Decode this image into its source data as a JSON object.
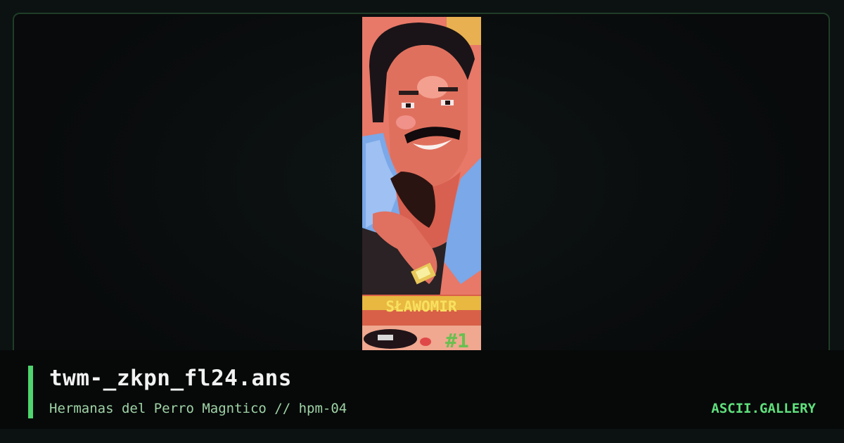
{
  "artwork": {
    "title": "twm-_zkpn_fl24.ans",
    "artist_line": "Hermanas del Perro Magntico // hpm-04",
    "banner_text": "SŁAWOMIR",
    "issue_mark": "#1"
  },
  "brand": {
    "label": "ASCII.GALLERY"
  },
  "colors": {
    "accent": "#4ed56f",
    "brand": "#5fe07c",
    "subtitle": "#9fd3a6",
    "title": "#f2f2f2"
  }
}
